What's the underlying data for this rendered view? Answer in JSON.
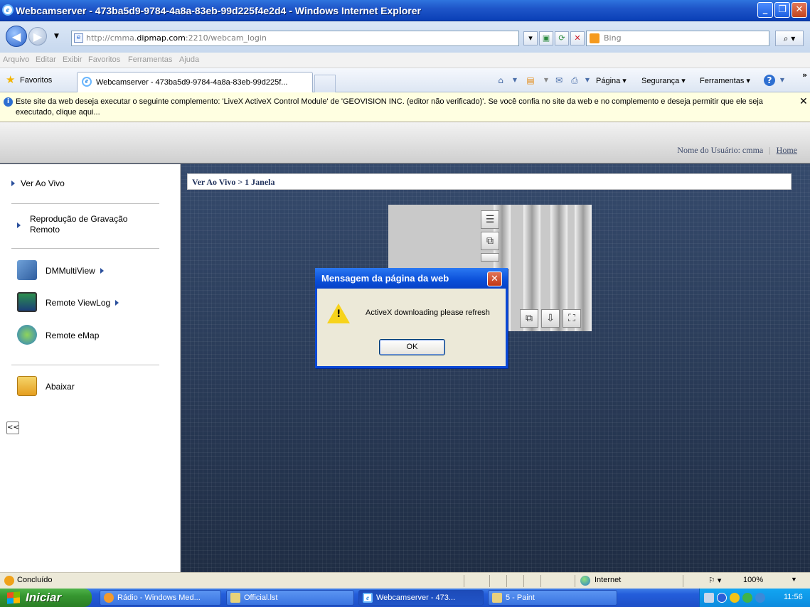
{
  "window": {
    "title": "Webcamserver - 473ba5d9-9784-4a8a-83eb-99d225f4e2d4 - Windows Internet Explorer"
  },
  "address": {
    "url_prefix": "http://cmma.",
    "url_domain": "dipmap.com",
    "url_suffix": ":2210/webcam_login",
    "search_placeholder": "Bing"
  },
  "menu": [
    "Arquivo",
    "Editar",
    "Exibir",
    "Favoritos",
    "Ferramentas",
    "Ajuda"
  ],
  "favbar": {
    "favorites_label": "Favoritos",
    "tab_title": "Webcamserver - 473ba5d9-9784-4a8a-83eb-99d225f...",
    "commands": [
      "Página ▾",
      "Segurança ▾",
      "Ferramentas ▾"
    ]
  },
  "infobar": {
    "message": "Este site da web deseja executar o seguinte complemento: 'LiveX ActiveX Control Module' de 'GEOVISION INC. (editor não verificado)'. Se você confia no site da web e no complemento e deseja permitir que ele seja executado, clique aqui..."
  },
  "page": {
    "user_label": "Nome do Usuário: cmma",
    "separator": "|",
    "home_link": "Home",
    "breadcrumb": "Ver Ao Vivo > 1 Janela",
    "sidebar": {
      "live": "Ver Ao Vivo",
      "playback": "Reprodução de Gravação Remoto",
      "dmmultiview": "DMMultiView",
      "viewlog": "Remote ViewLog",
      "emap": "Remote eMap",
      "download": "Abaixar",
      "collapse": "<<"
    }
  },
  "dialog": {
    "title": "Mensagem da página da web",
    "message": "ActiveX downloading please refresh",
    "ok": "OK"
  },
  "status": {
    "text": "Concluído",
    "zone": "Internet",
    "zoom": "100%"
  },
  "taskbar": {
    "start": "Iniciar",
    "tasks": [
      "Rádio - Windows Med...",
      "Official.lst",
      "Webcamserver - 473...",
      "5 - Paint"
    ],
    "clock": "11:56"
  },
  "colors": {
    "titlebar": "#0a3fb6",
    "page_background": "#25344e",
    "start_button": "#369630"
  }
}
